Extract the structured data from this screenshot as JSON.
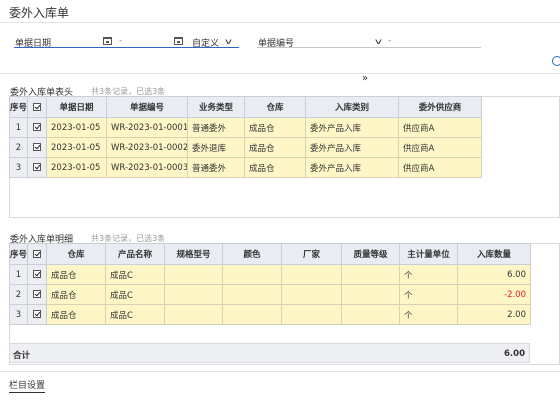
{
  "page": {
    "title": "委外入库单"
  },
  "filters": {
    "date_label": "单据日期",
    "date_separator": "-",
    "date_range_select": "自定义",
    "doc_no_label": "单据编号",
    "doc_no_separator": "-"
  },
  "header_section": {
    "title": "委外入库单表头",
    "count_text": "共3条记录，已选3条",
    "columns": [
      "序号",
      "",
      "单据日期",
      "单据编号",
      "业务类型",
      "仓库",
      "入库类别",
      "委外供应商"
    ],
    "rows": [
      {
        "idx": "1",
        "checked": true,
        "date": "2023-01-05",
        "doc_no": "WR-2023-01-0001",
        "biz_type": "普通委外",
        "warehouse": "成品仓",
        "category": "委外产品入库",
        "supplier": "供应商A"
      },
      {
        "idx": "2",
        "checked": true,
        "date": "2023-01-05",
        "doc_no": "WR-2023-01-0002",
        "biz_type": "委外退库",
        "warehouse": "成品仓",
        "category": "委外产品入库",
        "supplier": "供应商A"
      },
      {
        "idx": "3",
        "checked": true,
        "date": "2023-01-05",
        "doc_no": "WR-2023-01-0003",
        "biz_type": "普通委外",
        "warehouse": "成品仓",
        "category": "委外产品入库",
        "supplier": "供应商A"
      }
    ]
  },
  "detail_section": {
    "title": "委外入库单明细",
    "count_text": "共3条记录，已选3条",
    "columns": [
      "序号",
      "",
      "仓库",
      "产品名称",
      "规格型号",
      "颜色",
      "厂家",
      "质量等级",
      "主计量单位",
      "入库数量"
    ],
    "rows": [
      {
        "idx": "1",
        "checked": true,
        "warehouse": "成品仓",
        "product": "成品C",
        "spec": "",
        "color": "",
        "maker": "",
        "grade": "",
        "unit": "个",
        "qty": "6.00",
        "negative": false
      },
      {
        "idx": "2",
        "checked": true,
        "warehouse": "成品仓",
        "product": "成品C",
        "spec": "",
        "color": "",
        "maker": "",
        "grade": "",
        "unit": "个",
        "qty": "-2.00",
        "negative": true
      },
      {
        "idx": "3",
        "checked": true,
        "warehouse": "成品仓",
        "product": "成品C",
        "spec": "",
        "color": "",
        "maker": "",
        "grade": "",
        "unit": "个",
        "qty": "2.00",
        "negative": false
      }
    ],
    "total_label": "合计",
    "total_qty": "6.00"
  },
  "footer": {
    "column_settings": "栏目设置"
  },
  "colors": {
    "accent": "#2f66c3",
    "row_bg": "#fff6c7",
    "header_bg": "#e9ecf2",
    "negative": "#e02020"
  }
}
